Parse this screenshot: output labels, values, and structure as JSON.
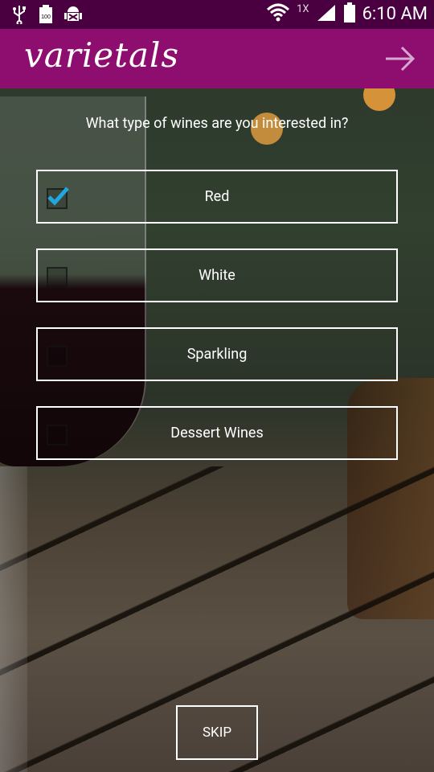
{
  "status_bar": {
    "battery_level": "100",
    "network_label": "1X",
    "time": "6:10 AM"
  },
  "app_bar": {
    "title": "varietals",
    "next_icon": "arrow-right-icon"
  },
  "prompt": "What type of wines are you interested in?",
  "options": [
    {
      "label": "Red",
      "checked": true
    },
    {
      "label": "White",
      "checked": false
    },
    {
      "label": "Sparkling",
      "checked": false
    },
    {
      "label": "Dessert Wines",
      "checked": false
    }
  ],
  "skip_label": "SKIP",
  "colors": {
    "app_bar": "#8d0e6f",
    "status_bar": "#4a0040",
    "check_accent": "#1ea7e1"
  }
}
